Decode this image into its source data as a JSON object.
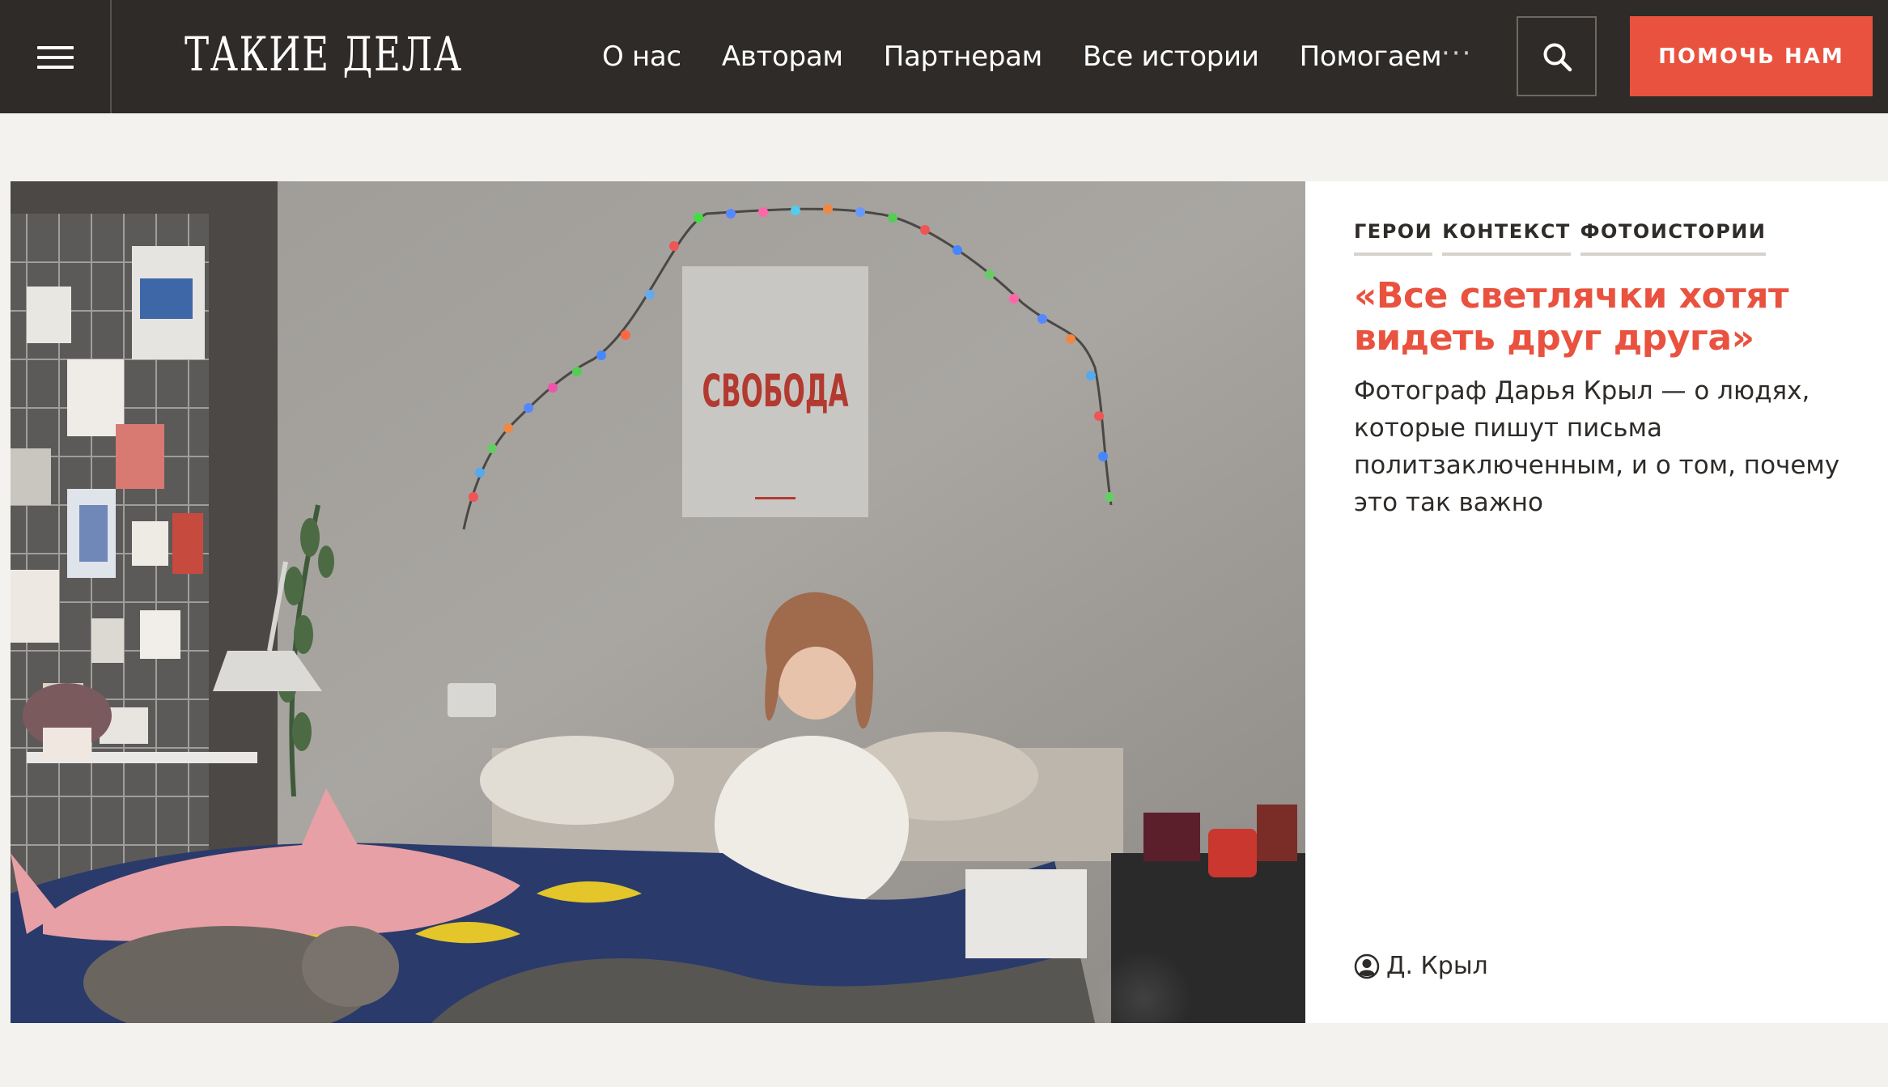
{
  "header": {
    "logo": "ТАКИЕ ДЕЛА",
    "nav": [
      "О нас",
      "Авторам",
      "Партнерам",
      "Все истории",
      "Помогаем"
    ],
    "more": "···",
    "help_button": "ПОМОЧЬ НАМ"
  },
  "article": {
    "tags": [
      "ГЕРОИ",
      "КОНТЕКСТ",
      "ФОТОИСТОРИИ"
    ],
    "title": "«Все светлячки хотят видеть друг друга»",
    "lead": "Фотограф Дарья Крыл — о людях, которые пишут письма политзаключенным, и о том, почему это так важно",
    "author": "Д. Крыл",
    "photo": {
      "poster_text": "СВОБОДА"
    }
  },
  "colors": {
    "header_bg": "#2e2b28",
    "accent": "#e9523f",
    "page_bg": "#f4f2ee"
  },
  "icons": [
    "menu-icon",
    "search-icon",
    "user-icon"
  ]
}
